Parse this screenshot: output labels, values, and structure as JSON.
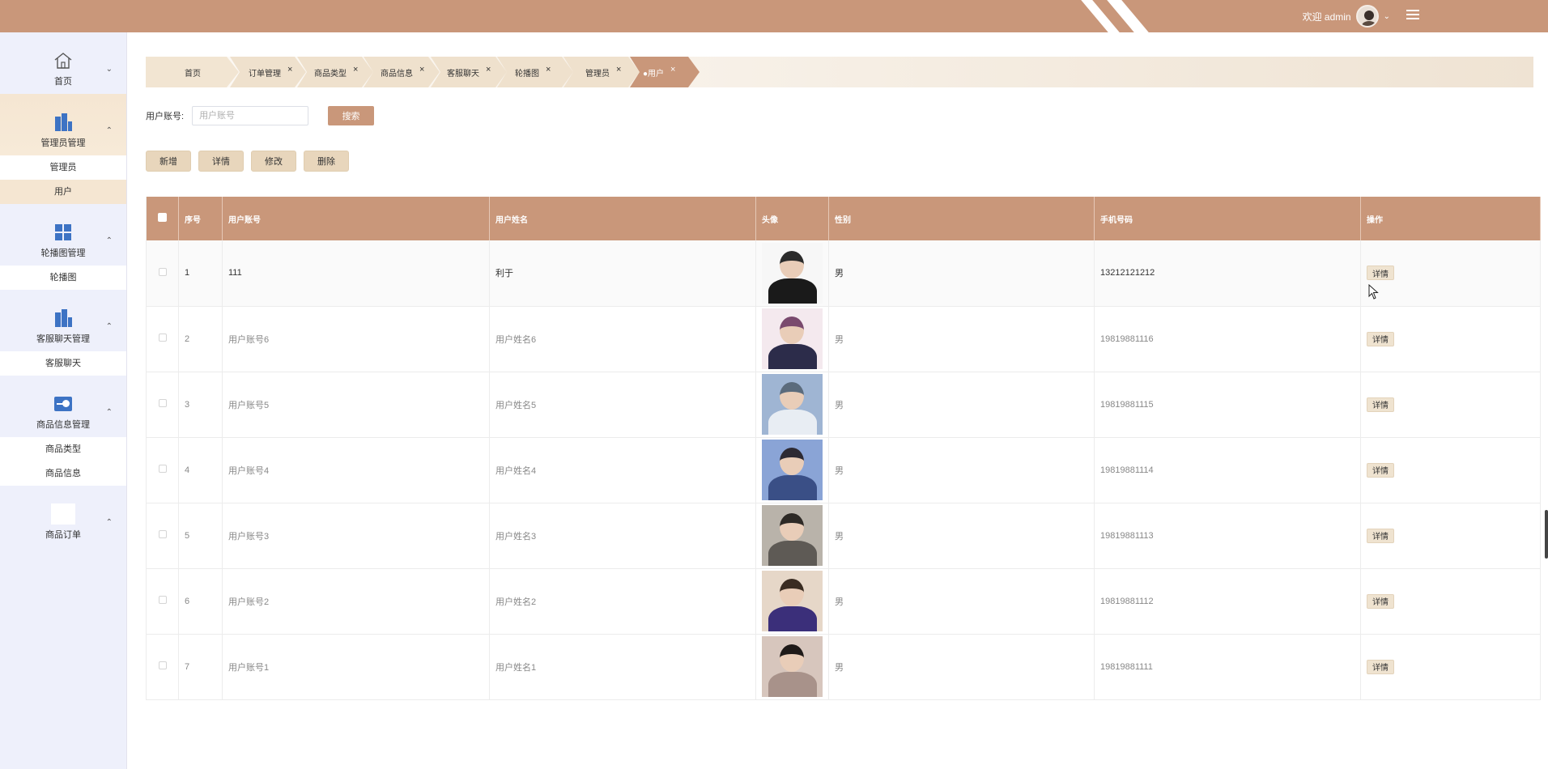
{
  "header": {
    "welcome": "欢迎 admin",
    "icons": {
      "avatar": "user-avatar",
      "dropdown": "chevron-down-icon",
      "menu": "hamburger-icon"
    },
    "colors": {
      "brand": "#c9977a"
    }
  },
  "sidebar": {
    "groups": [
      {
        "label": "首页",
        "icon": "home-icon",
        "arrow": "⌄",
        "items": []
      },
      {
        "label": "管理员管理",
        "icon": "building-icon",
        "arrow": "⌃",
        "items": [
          "管理员",
          "用户"
        ]
      },
      {
        "label": "轮播图管理",
        "icon": "grid-icon",
        "arrow": "⌃",
        "items": [
          "轮播图"
        ]
      },
      {
        "label": "客服聊天管理",
        "icon": "building-icon",
        "arrow": "⌃",
        "items": [
          "客服聊天"
        ]
      },
      {
        "label": "商品信息管理",
        "icon": "switch-icon",
        "arrow": "⌃",
        "items": [
          "商品类型",
          "商品信息"
        ]
      },
      {
        "label": "商品订单",
        "icon": "blank-icon",
        "arrow": "⌃",
        "items": []
      }
    ],
    "active_item": "用户"
  },
  "tabs": [
    {
      "label": "首页",
      "closable": false,
      "active": false
    },
    {
      "label": "订单管理",
      "closable": true,
      "active": false
    },
    {
      "label": "商品类型",
      "closable": true,
      "active": false
    },
    {
      "label": "商品信息",
      "closable": true,
      "active": false
    },
    {
      "label": "客服聊天",
      "closable": true,
      "active": false
    },
    {
      "label": "轮播图",
      "closable": true,
      "active": false
    },
    {
      "label": "管理员",
      "closable": true,
      "active": false
    },
    {
      "label": "●用户",
      "closable": true,
      "active": true
    }
  ],
  "close_glyph": "×",
  "search": {
    "label": "用户账号:",
    "placeholder": "用户账号",
    "button": "搜索"
  },
  "actions": {
    "add": "新增",
    "detail": "详情",
    "edit": "修改",
    "delete": "删除"
  },
  "table": {
    "columns": [
      "序号",
      "用户账号",
      "用户姓名",
      "头像",
      "性别",
      "手机号码",
      "操作"
    ],
    "detail_label": "详情",
    "rows": [
      {
        "index": "1",
        "account": "111",
        "name": "利于",
        "gender": "男",
        "phone": "13212121212"
      },
      {
        "index": "2",
        "account": "用户账号6",
        "name": "用户姓名6",
        "gender": "男",
        "phone": "19819881116"
      },
      {
        "index": "3",
        "account": "用户账号5",
        "name": "用户姓名5",
        "gender": "男",
        "phone": "19819881115"
      },
      {
        "index": "4",
        "account": "用户账号4",
        "name": "用户姓名4",
        "gender": "男",
        "phone": "19819881114"
      },
      {
        "index": "5",
        "account": "用户账号3",
        "name": "用户姓名3",
        "gender": "男",
        "phone": "19819881113"
      },
      {
        "index": "6",
        "account": "用户账号2",
        "name": "用户姓名2",
        "gender": "男",
        "phone": "19819881112"
      },
      {
        "index": "7",
        "account": "用户账号1",
        "name": "用户姓名1",
        "gender": "男",
        "phone": "19819881111"
      }
    ]
  }
}
